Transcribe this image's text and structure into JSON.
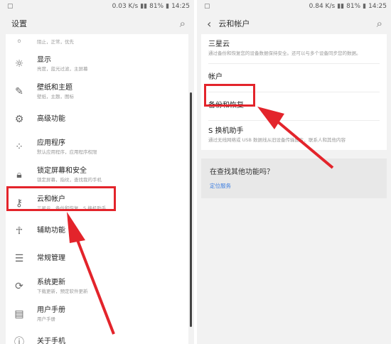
{
  "left": {
    "status": {
      "speed": "0.03 K/s",
      "battery": "81%",
      "time": "14:25"
    },
    "title": "设置",
    "items": [
      {
        "title": "",
        "subtitle": "阻止，正常，优先",
        "icon": "partial-icon"
      },
      {
        "title": "显示",
        "subtitle": "亮度，蓝光过滤，主屏幕",
        "icon": "display-icon"
      },
      {
        "title": "壁纸和主题",
        "subtitle": "壁纸，主题，图标",
        "icon": "brush-icon"
      },
      {
        "title": "高级功能",
        "subtitle": "",
        "icon": "gear-plus-icon"
      },
      {
        "title": "应用程序",
        "subtitle": "默认应用程序，应用程序权限",
        "icon": "apps-icon"
      },
      {
        "title": "锁定屏幕和安全",
        "subtitle": "锁定屏幕，指纹，查找我的手机",
        "icon": "lock-icon"
      },
      {
        "title": "云和帐户",
        "subtitle": "三星云，备份和恢复，S 换机助手",
        "icon": "key-icon"
      },
      {
        "title": "辅助功能",
        "subtitle": "",
        "icon": "accessibility-icon"
      },
      {
        "title": "常规管理",
        "subtitle": "",
        "icon": "sliders-icon"
      },
      {
        "title": "系统更新",
        "subtitle": "下载更新，预定软件更新",
        "icon": "update-icon"
      },
      {
        "title": "用户手册",
        "subtitle": "用户手册",
        "icon": "manual-icon"
      },
      {
        "title": "关于手机",
        "subtitle": "",
        "icon": "info-icon"
      }
    ]
  },
  "right": {
    "status": {
      "speed": "0.84 K/s",
      "battery": "81%",
      "time": "14:25"
    },
    "title": "云和帐户",
    "items": [
      {
        "title": "三星云",
        "subtitle": "通过备份和恢复您的设备数据保持安全。还可以与多个设备同步您的数据。"
      },
      {
        "title": "帐户",
        "subtitle": ""
      },
      {
        "title": "备份和恢复",
        "subtitle": ""
      },
      {
        "title": "S 换机助手",
        "subtitle": "通过无线网络或 USB 数据线从旧设备传输图片、联系人和其他内容"
      }
    ],
    "more": {
      "question": "在查找其他功能吗？",
      "link": "定位服务"
    }
  },
  "colors": {
    "highlight": "#e3242b",
    "link": "#3b7de0"
  }
}
